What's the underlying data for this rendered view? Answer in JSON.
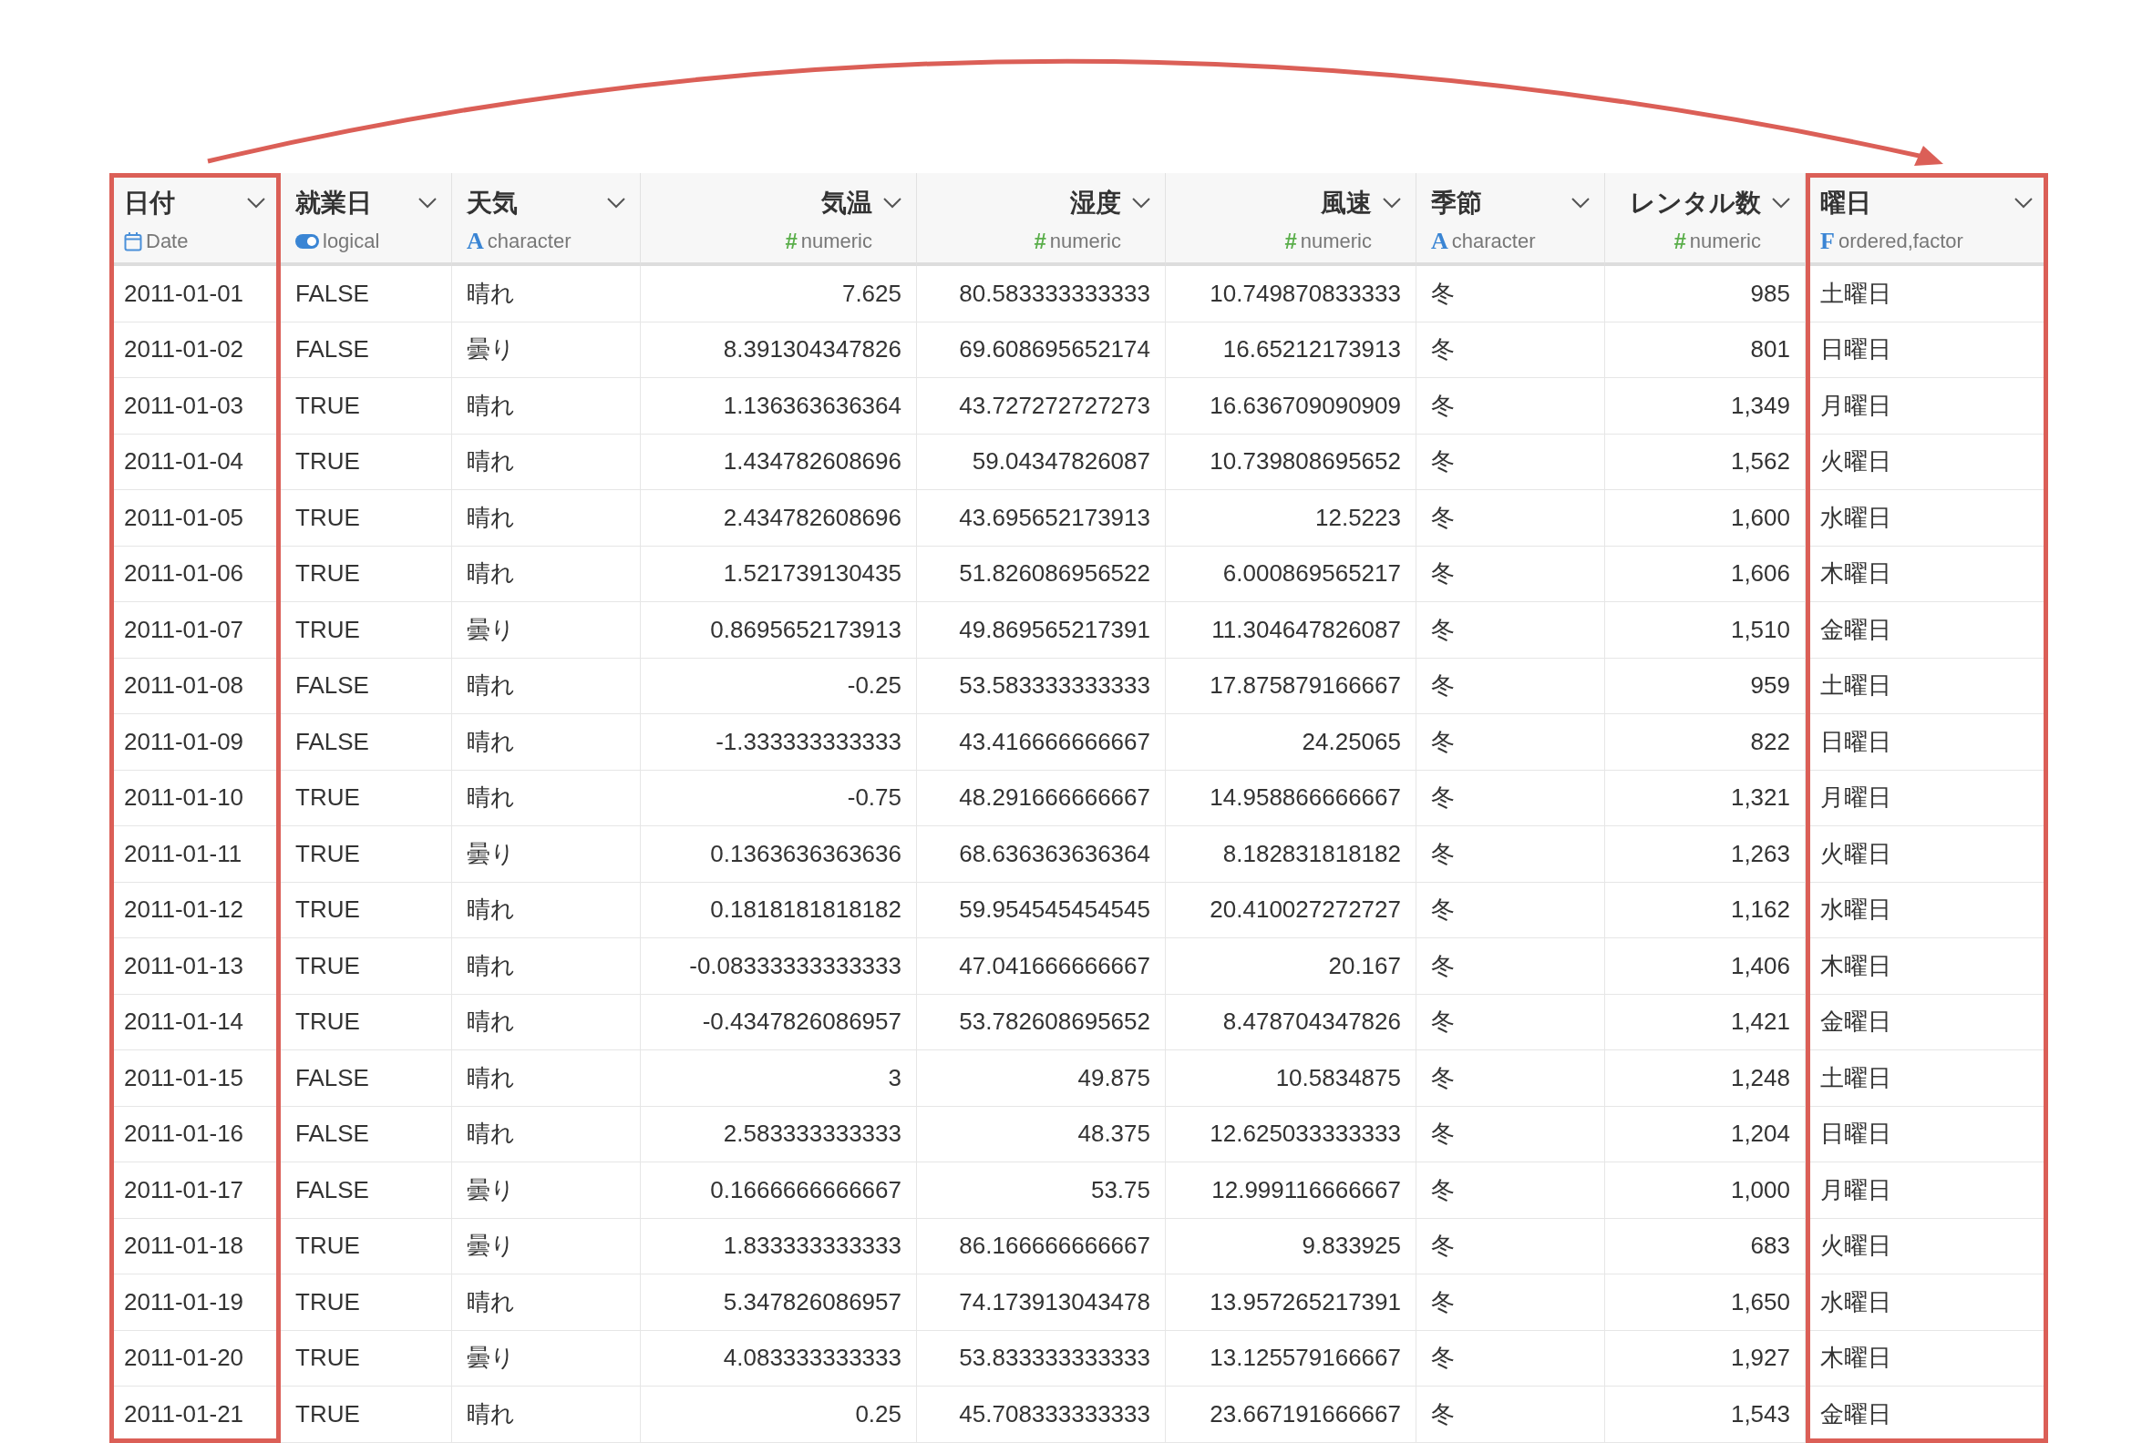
{
  "columns": [
    {
      "name": "日付",
      "kind": "date",
      "type": "Date",
      "highlighted": true
    },
    {
      "name": "就業日",
      "kind": "logical",
      "type": "logical",
      "highlighted": false
    },
    {
      "name": "天気",
      "kind": "character",
      "mark": "A",
      "type": "character",
      "highlighted": false
    },
    {
      "name": "気温",
      "kind": "numeric",
      "mark": "#",
      "type": "numeric",
      "highlighted": false
    },
    {
      "name": "湿度",
      "kind": "numeric",
      "mark": "#",
      "type": "numeric",
      "highlighted": false
    },
    {
      "name": "風速",
      "kind": "numeric",
      "mark": "#",
      "type": "numeric",
      "highlighted": false
    },
    {
      "name": "季節",
      "kind": "character",
      "mark": "A",
      "type": "character",
      "highlighted": false
    },
    {
      "name": "レンタル数",
      "kind": "numeric",
      "mark": "#",
      "type": "numeric",
      "highlighted": false
    },
    {
      "name": "曜日",
      "kind": "factor",
      "mark": "F",
      "type": "ordered,factor",
      "highlighted": true
    }
  ],
  "rows": [
    [
      "2011-01-01",
      "FALSE",
      "晴れ",
      "7.625",
      "80.583333333333",
      "10.749870833333",
      "冬",
      "985",
      "土曜日"
    ],
    [
      "2011-01-02",
      "FALSE",
      "曇り",
      "8.391304347826",
      "69.608695652174",
      "16.65212173913",
      "冬",
      "801",
      "日曜日"
    ],
    [
      "2011-01-03",
      "TRUE",
      "晴れ",
      "1.136363636364",
      "43.727272727273",
      "16.636709090909",
      "冬",
      "1,349",
      "月曜日"
    ],
    [
      "2011-01-04",
      "TRUE",
      "晴れ",
      "1.434782608696",
      "59.04347826087",
      "10.739808695652",
      "冬",
      "1,562",
      "火曜日"
    ],
    [
      "2011-01-05",
      "TRUE",
      "晴れ",
      "2.434782608696",
      "43.695652173913",
      "12.5223",
      "冬",
      "1,600",
      "水曜日"
    ],
    [
      "2011-01-06",
      "TRUE",
      "晴れ",
      "1.521739130435",
      "51.826086956522",
      "6.000869565217",
      "冬",
      "1,606",
      "木曜日"
    ],
    [
      "2011-01-07",
      "TRUE",
      "曇り",
      "0.8695652173913",
      "49.869565217391",
      "11.304647826087",
      "冬",
      "1,510",
      "金曜日"
    ],
    [
      "2011-01-08",
      "FALSE",
      "晴れ",
      "-0.25",
      "53.583333333333",
      "17.875879166667",
      "冬",
      "959",
      "土曜日"
    ],
    [
      "2011-01-09",
      "FALSE",
      "晴れ",
      "-1.333333333333",
      "43.416666666667",
      "24.25065",
      "冬",
      "822",
      "日曜日"
    ],
    [
      "2011-01-10",
      "TRUE",
      "晴れ",
      "-0.75",
      "48.291666666667",
      "14.958866666667",
      "冬",
      "1,321",
      "月曜日"
    ],
    [
      "2011-01-11",
      "TRUE",
      "曇り",
      "0.1363636363636",
      "68.636363636364",
      "8.182831818182",
      "冬",
      "1,263",
      "火曜日"
    ],
    [
      "2011-01-12",
      "TRUE",
      "晴れ",
      "0.1818181818182",
      "59.954545454545",
      "20.410027272727",
      "冬",
      "1,162",
      "水曜日"
    ],
    [
      "2011-01-13",
      "TRUE",
      "晴れ",
      "-0.08333333333333",
      "47.041666666667",
      "20.167",
      "冬",
      "1,406",
      "木曜日"
    ],
    [
      "2011-01-14",
      "TRUE",
      "晴れ",
      "-0.4347826086957",
      "53.782608695652",
      "8.478704347826",
      "冬",
      "1,421",
      "金曜日"
    ],
    [
      "2011-01-15",
      "FALSE",
      "晴れ",
      "3",
      "49.875",
      "10.5834875",
      "冬",
      "1,248",
      "土曜日"
    ],
    [
      "2011-01-16",
      "FALSE",
      "晴れ",
      "2.583333333333",
      "48.375",
      "12.625033333333",
      "冬",
      "1,204",
      "日曜日"
    ],
    [
      "2011-01-17",
      "FALSE",
      "曇り",
      "0.1666666666667",
      "53.75",
      "12.999116666667",
      "冬",
      "1,000",
      "月曜日"
    ],
    [
      "2011-01-18",
      "TRUE",
      "曇り",
      "1.833333333333",
      "86.166666666667",
      "9.833925",
      "冬",
      "683",
      "火曜日"
    ],
    [
      "2011-01-19",
      "TRUE",
      "晴れ",
      "5.347826086957",
      "74.173913043478",
      "13.957265217391",
      "冬",
      "1,650",
      "水曜日"
    ],
    [
      "2011-01-20",
      "TRUE",
      "曇り",
      "4.083333333333",
      "53.833333333333",
      "13.125579166667",
      "冬",
      "1,927",
      "木曜日"
    ],
    [
      "2011-01-21",
      "TRUE",
      "晴れ",
      "0.25",
      "45.708333333333",
      "23.667191666667",
      "冬",
      "1,543",
      "金曜日"
    ]
  ]
}
